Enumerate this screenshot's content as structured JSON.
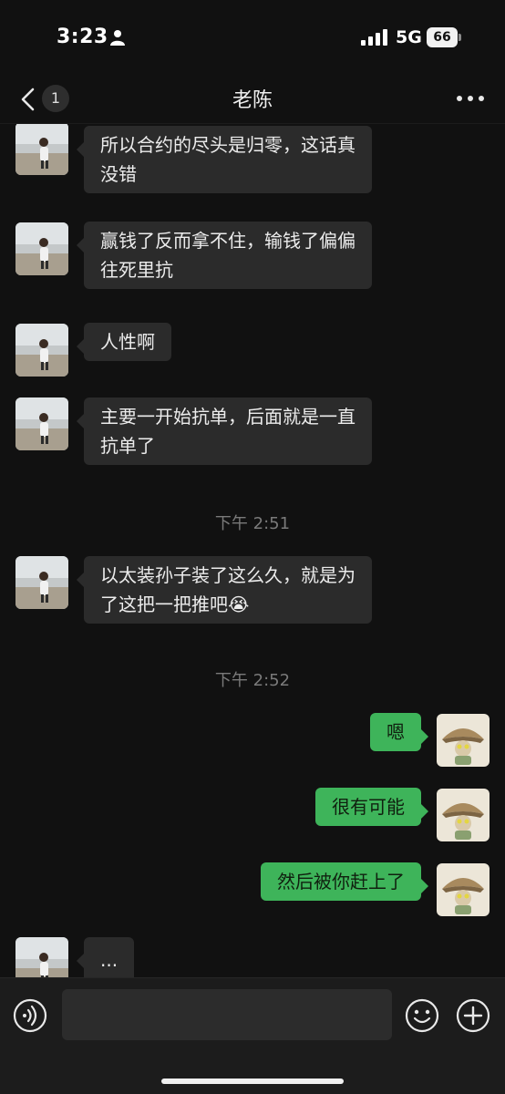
{
  "status_bar": {
    "time": "3:23",
    "network": "5G",
    "battery": "66"
  },
  "nav": {
    "unread_count": "1",
    "title": "老陈"
  },
  "messages": [
    {
      "side": "left",
      "lines": [
        "所以合约的尽头是归零，这话真",
        "没错"
      ]
    },
    {
      "side": "left",
      "lines": [
        "赢钱了反而拿不住，输钱了偏偏",
        "往死里抗"
      ]
    },
    {
      "side": "left",
      "lines": [
        "人性啊"
      ]
    },
    {
      "side": "left",
      "lines": [
        "主要一开始抗单，后面就是一直",
        "抗单了"
      ]
    },
    {
      "type": "time",
      "text": "下午 2:51"
    },
    {
      "side": "left",
      "lines": [
        "以太装孙子装了这么久，就是为",
        "了这把一把推吧😭"
      ]
    },
    {
      "type": "time",
      "text": "下午 2:52"
    },
    {
      "side": "right",
      "lines": [
        "嗯"
      ]
    },
    {
      "side": "right",
      "lines": [
        "很有可能"
      ]
    },
    {
      "side": "right",
      "lines": [
        "然后被你赶上了"
      ]
    },
    {
      "side": "left",
      "lines": [
        "..."
      ]
    }
  ],
  "input": {
    "value": "",
    "placeholder": ""
  },
  "icons": {
    "back": "chevron-left-icon",
    "more": "more-dots-icon",
    "voice": "voice-icon",
    "emoji": "emoji-icon",
    "add": "plus-circle-icon"
  },
  "colors": {
    "background": "#111111",
    "bubble_incoming": "#2b2b2b",
    "bubble_outgoing": "#3eb45a",
    "input_bar": "#1c1c1c"
  }
}
